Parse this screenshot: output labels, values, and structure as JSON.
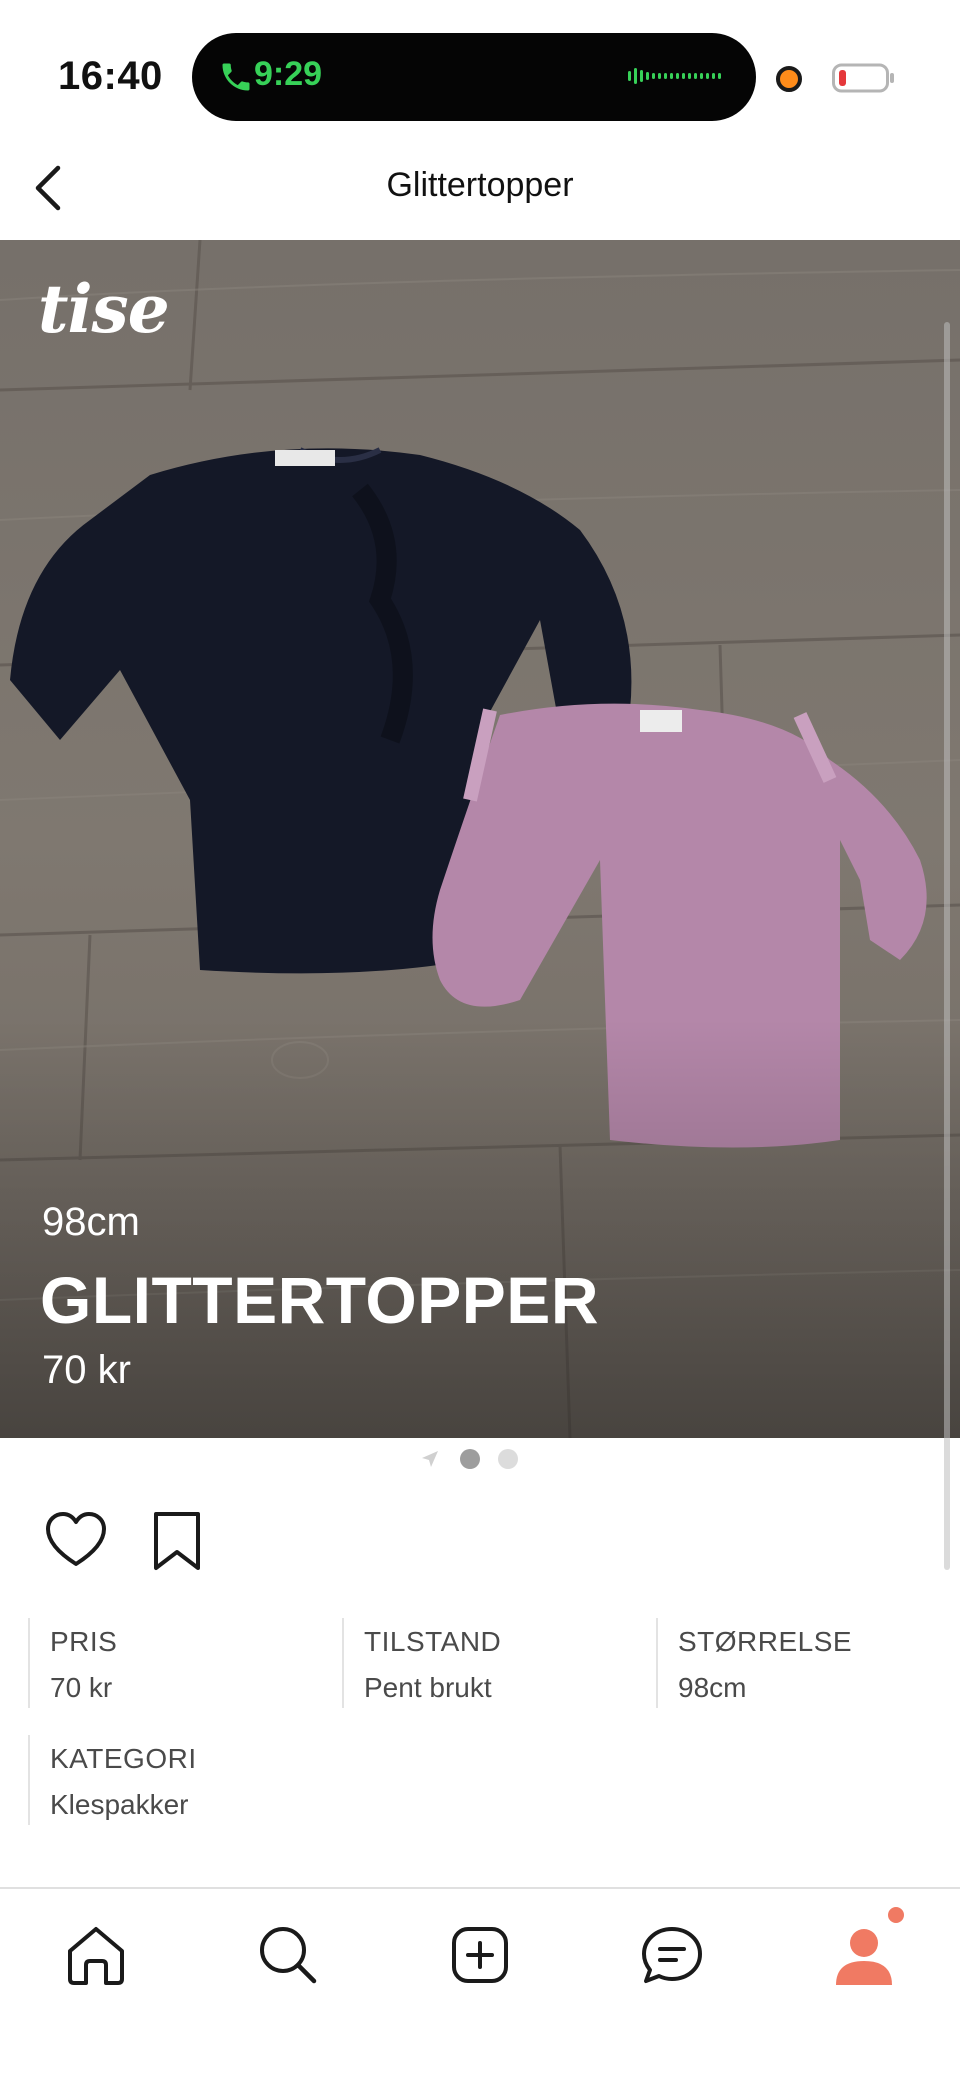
{
  "status_bar": {
    "clock": "16:40",
    "call_time": "9:29"
  },
  "nav": {
    "title": "Glittertopper"
  },
  "hero": {
    "brand": "tise",
    "size": "98cm",
    "title": "GLITTERTOPPER",
    "price": "70 kr"
  },
  "carousel": {
    "total_pages": 2,
    "active_page": 1
  },
  "attributes": {
    "price": {
      "label": "PRIS",
      "value": "70 kr"
    },
    "condition": {
      "label": "TILSTAND",
      "value": "Pent brukt"
    },
    "size": {
      "label": "STØRRELSE",
      "value": "98cm"
    },
    "category": {
      "label": "KATEGORI",
      "value": "Klespakker"
    }
  },
  "tab_bar": {
    "items": [
      {
        "icon": "home-icon"
      },
      {
        "icon": "search-icon"
      },
      {
        "icon": "add-icon"
      },
      {
        "icon": "messages-icon"
      },
      {
        "icon": "profile-icon",
        "notification": true
      }
    ]
  },
  "colors": {
    "call_green": "#37d158",
    "accent_coral": "#f07a63",
    "battery_red": "#e5383b",
    "text_gray": "#4a4a4a"
  }
}
